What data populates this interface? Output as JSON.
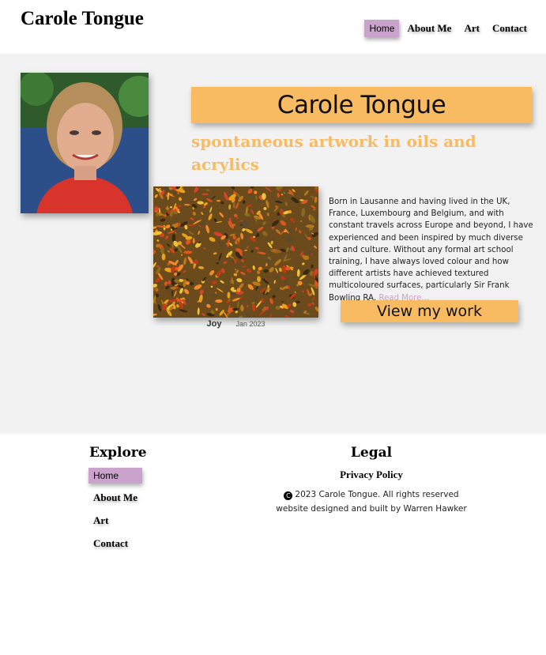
{
  "header": {
    "site_title": "Carole Tongue",
    "nav": [
      "Home",
      "About Me",
      "Art",
      "Contact"
    ]
  },
  "hero": {
    "name": "Carole Tongue",
    "tagline": "spontaneous artwork in oils and acrylics"
  },
  "featured_art": {
    "title": "Joy",
    "date": "Jan 2023"
  },
  "bio": {
    "text": "Born in Lausanne and having lived in the UK, France, Luxembourg and Belgium, and with constant travels across Europe and beyond, I have experienced and been inspired by much diverse art and culture. Without any formal art school training, I have always loved colour and how different artists have achieved textured multicoloured surfaces, particularly Sir Frank Bowling RA.",
    "read_more": "Read More..."
  },
  "cta": {
    "view_work": "View my work"
  },
  "footer": {
    "explore_heading": "Explore",
    "explore_links": [
      "Home",
      "About Me",
      "Art",
      "Contact"
    ],
    "legal_heading": "Legal",
    "privacy": "Privacy Policy",
    "copyright": "2023 Carole Tongue. All rights reserved",
    "credit": "website designed and built by Warren Hawker"
  },
  "colors": {
    "accent_orange": "#f9bb62",
    "accent_purple": "#c9a3cc",
    "main_bg": "#f2f2f2"
  },
  "icons": {
    "copyright": "copyright-icon"
  }
}
